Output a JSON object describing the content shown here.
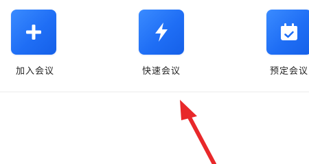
{
  "quick_actions": [
    {
      "label": "加入会议",
      "icon": "plus-icon"
    },
    {
      "label": "快速会议",
      "icon": "lightning-icon"
    },
    {
      "label": "预定会议",
      "icon": "calendar-check-icon"
    }
  ],
  "colors": {
    "accent": "#1f6ef5",
    "annotation_arrow": "#e8282a"
  }
}
